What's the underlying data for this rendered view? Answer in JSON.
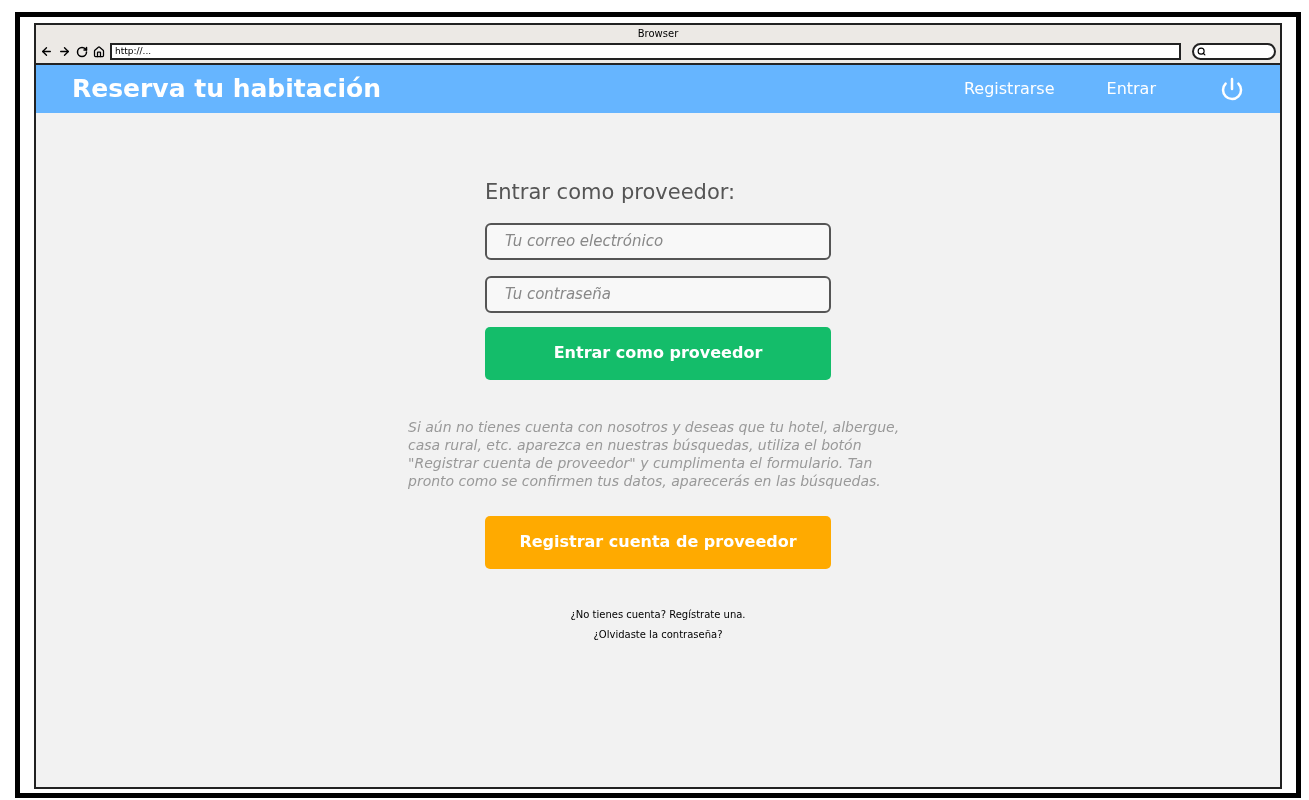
{
  "browser": {
    "title": "Browser",
    "url": "http://..."
  },
  "navbar": {
    "brand": "Reserva tu habitación",
    "links": [
      "Registrarse",
      "Entrar"
    ]
  },
  "login": {
    "heading": "Entrar como proveedor:",
    "email": {
      "placeholder": "Tu correo electrónico"
    },
    "password": {
      "placeholder": "Tu contraseña"
    },
    "submit": "Entrar como proveedor",
    "info": "Si aún no tienes cuenta con nosotros y deseas que tu hotel, albergue, casa rural, etc. aparezca en nuestras búsquedas, utiliza el botón \"Registrar cuenta de proveedor\" y cumplimenta el formulario. Tan pronto como se confirmen tus datos, aparecerás en las búsquedas.",
    "register": "Registrar cuenta de proveedor",
    "links": [
      "¿No tienes cuenta? Regístrate una.",
      "¿Olvidaste la contraseña?"
    ]
  }
}
